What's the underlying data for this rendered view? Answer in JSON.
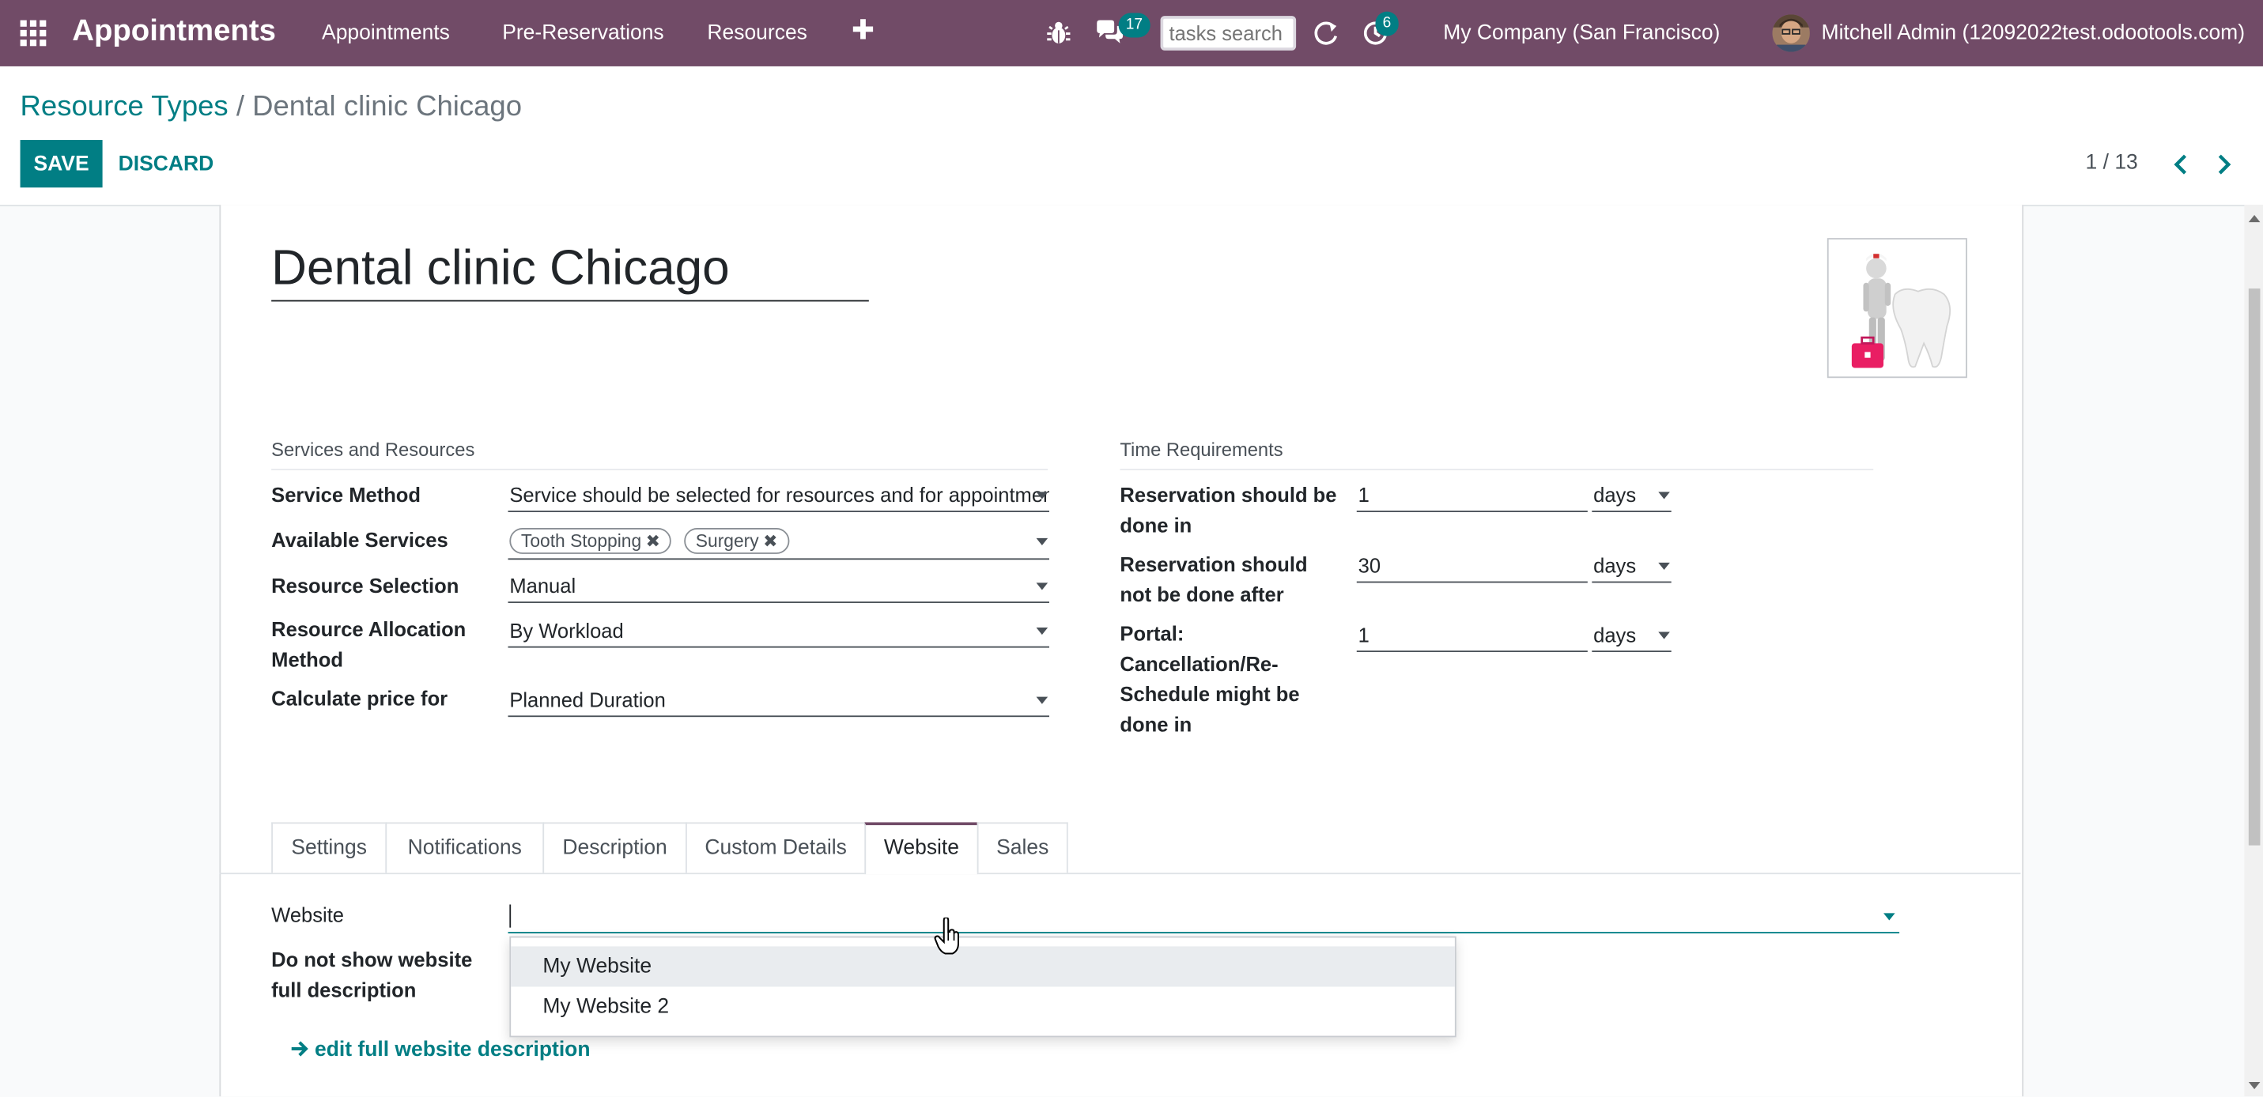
{
  "navbar": {
    "app_name": "Appointments",
    "menu": [
      "Appointments",
      "Pre-Reservations",
      "Resources"
    ],
    "plus_label": "✚",
    "chat_count": "17",
    "activity_count": "6",
    "tasks_search_placeholder": "tasks search",
    "company": "My Company (San Francisco)",
    "user": "Mitchell Admin (12092022test.odootools.com)"
  },
  "breadcrumb": {
    "parent": "Resource Types",
    "separator": "/",
    "current": "Dental clinic Chicago"
  },
  "buttons": {
    "save": "SAVE",
    "discard": "DISCARD"
  },
  "pager": {
    "value": "1 / 13"
  },
  "form": {
    "name": "Dental clinic Chicago",
    "services_group": {
      "title": "Services and Resources",
      "service_method_label": "Service Method",
      "service_method_value": "Service should be selected for resources and for appointments",
      "available_services_label": "Available Services",
      "available_services_tags": [
        "Tooth Stopping",
        "Surgery"
      ],
      "resource_selection_label": "Resource Selection",
      "resource_selection_value": "Manual",
      "resource_allocation_label": "Resource Allocation Method",
      "resource_allocation_value": "By Workload",
      "calculate_price_label": "Calculate price for",
      "calculate_price_value": "Planned Duration"
    },
    "time_group": {
      "title": "Time Requirements",
      "rows": [
        {
          "label": "Reservation should be done in",
          "value": "1",
          "unit": "days"
        },
        {
          "label": "Reservation should not be done after",
          "value": "30",
          "unit": "days"
        },
        {
          "label": "Portal: Cancellation/Re-Schedule might be done in",
          "value": "1",
          "unit": "days"
        }
      ]
    }
  },
  "tabs": [
    "Settings",
    "Notifications",
    "Description",
    "Custom Details",
    "Website",
    "Sales"
  ],
  "active_tab": "Website",
  "website_tab": {
    "website_label": "Website",
    "website_value": "",
    "do_not_show_label": "Do not show website full description",
    "dropdown_options": [
      "My Website",
      "My Website 2"
    ],
    "edit_link": "edit full website description"
  },
  "colors": {
    "brand": "#714b67",
    "accent": "#017e84"
  }
}
